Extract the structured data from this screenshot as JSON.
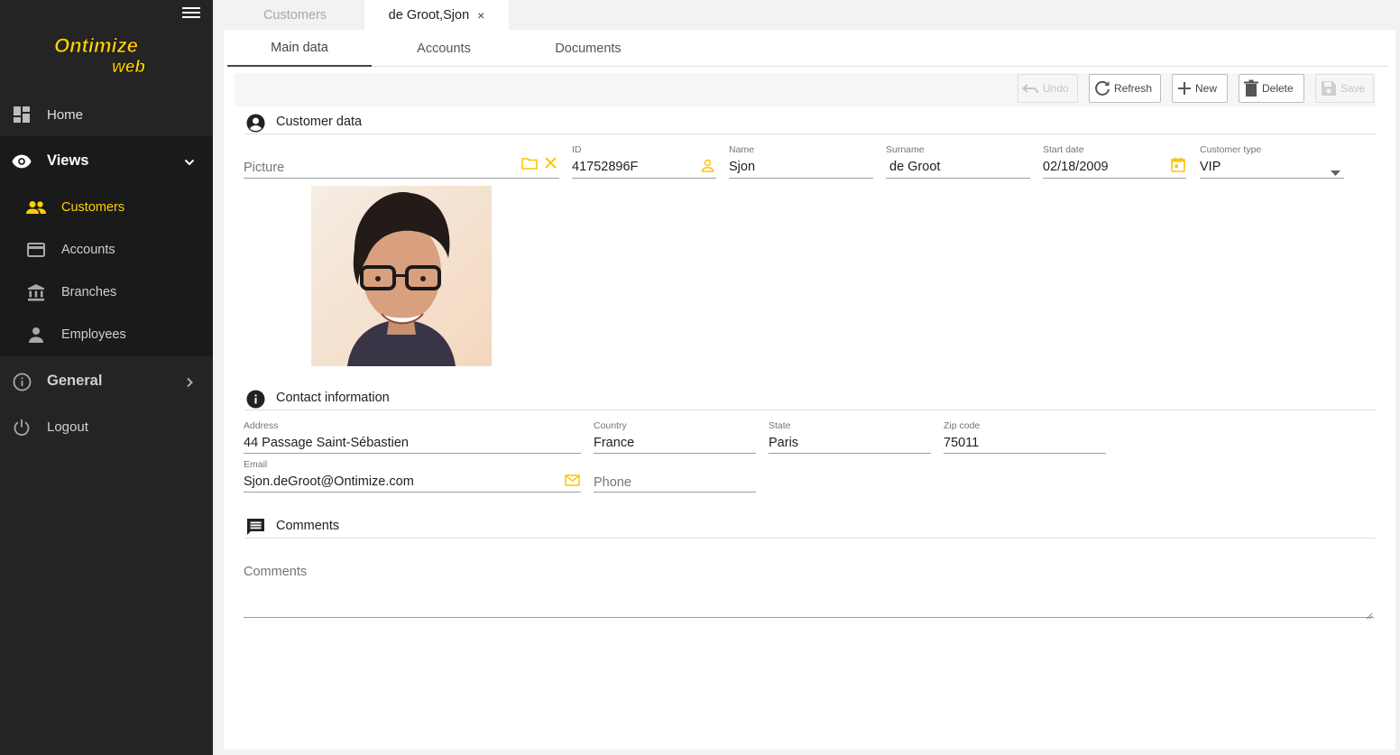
{
  "app": {
    "logo_text": "Ontimize web"
  },
  "sidebar": {
    "home": "Home",
    "views": "Views",
    "views_items": [
      {
        "label": "Customers",
        "icon": "people-icon",
        "active": true
      },
      {
        "label": "Accounts",
        "icon": "credit-card-icon"
      },
      {
        "label": "Branches",
        "icon": "bank-icon"
      },
      {
        "label": "Employees",
        "icon": "person-icon"
      }
    ],
    "general": "General",
    "logout": "Logout"
  },
  "tabs": {
    "list": "Customers",
    "detail": "de Groot,Sjon",
    "close_glyph": "×"
  },
  "subtabs": [
    "Main data",
    "Accounts",
    "Documents"
  ],
  "toolbar": {
    "undo": "Undo",
    "refresh": "Refresh",
    "new": "New",
    "delete": "Delete",
    "save": "Save"
  },
  "customer_data": {
    "title": "Customer data",
    "picture_placeholder": "Picture",
    "id_label": "ID",
    "id": "41752896F",
    "name_label": "Name",
    "name": "Sjon",
    "surname_label": "Surname",
    "surname": "de Groot",
    "start_date_label": "Start date",
    "start_date": "02/18/2009",
    "type_label": "Customer type",
    "type": "VIP"
  },
  "contact": {
    "title": "Contact information",
    "address_label": "Address",
    "address": "44 Passage Saint-Sébastien",
    "country_label": "Country",
    "country": "France",
    "state_label": "State",
    "state": "Paris",
    "zip_label": "Zip code",
    "zip": "75011",
    "email_label": "Email",
    "email": "Sjon.deGroot@Ontimize.com",
    "phone_placeholder": "Phone"
  },
  "comments": {
    "title": "Comments",
    "placeholder": "Comments"
  },
  "colors": {
    "accent": "#ffd000",
    "sidebar_bg": "#242424",
    "sidebar_group_bg": "#1a1a1a"
  }
}
